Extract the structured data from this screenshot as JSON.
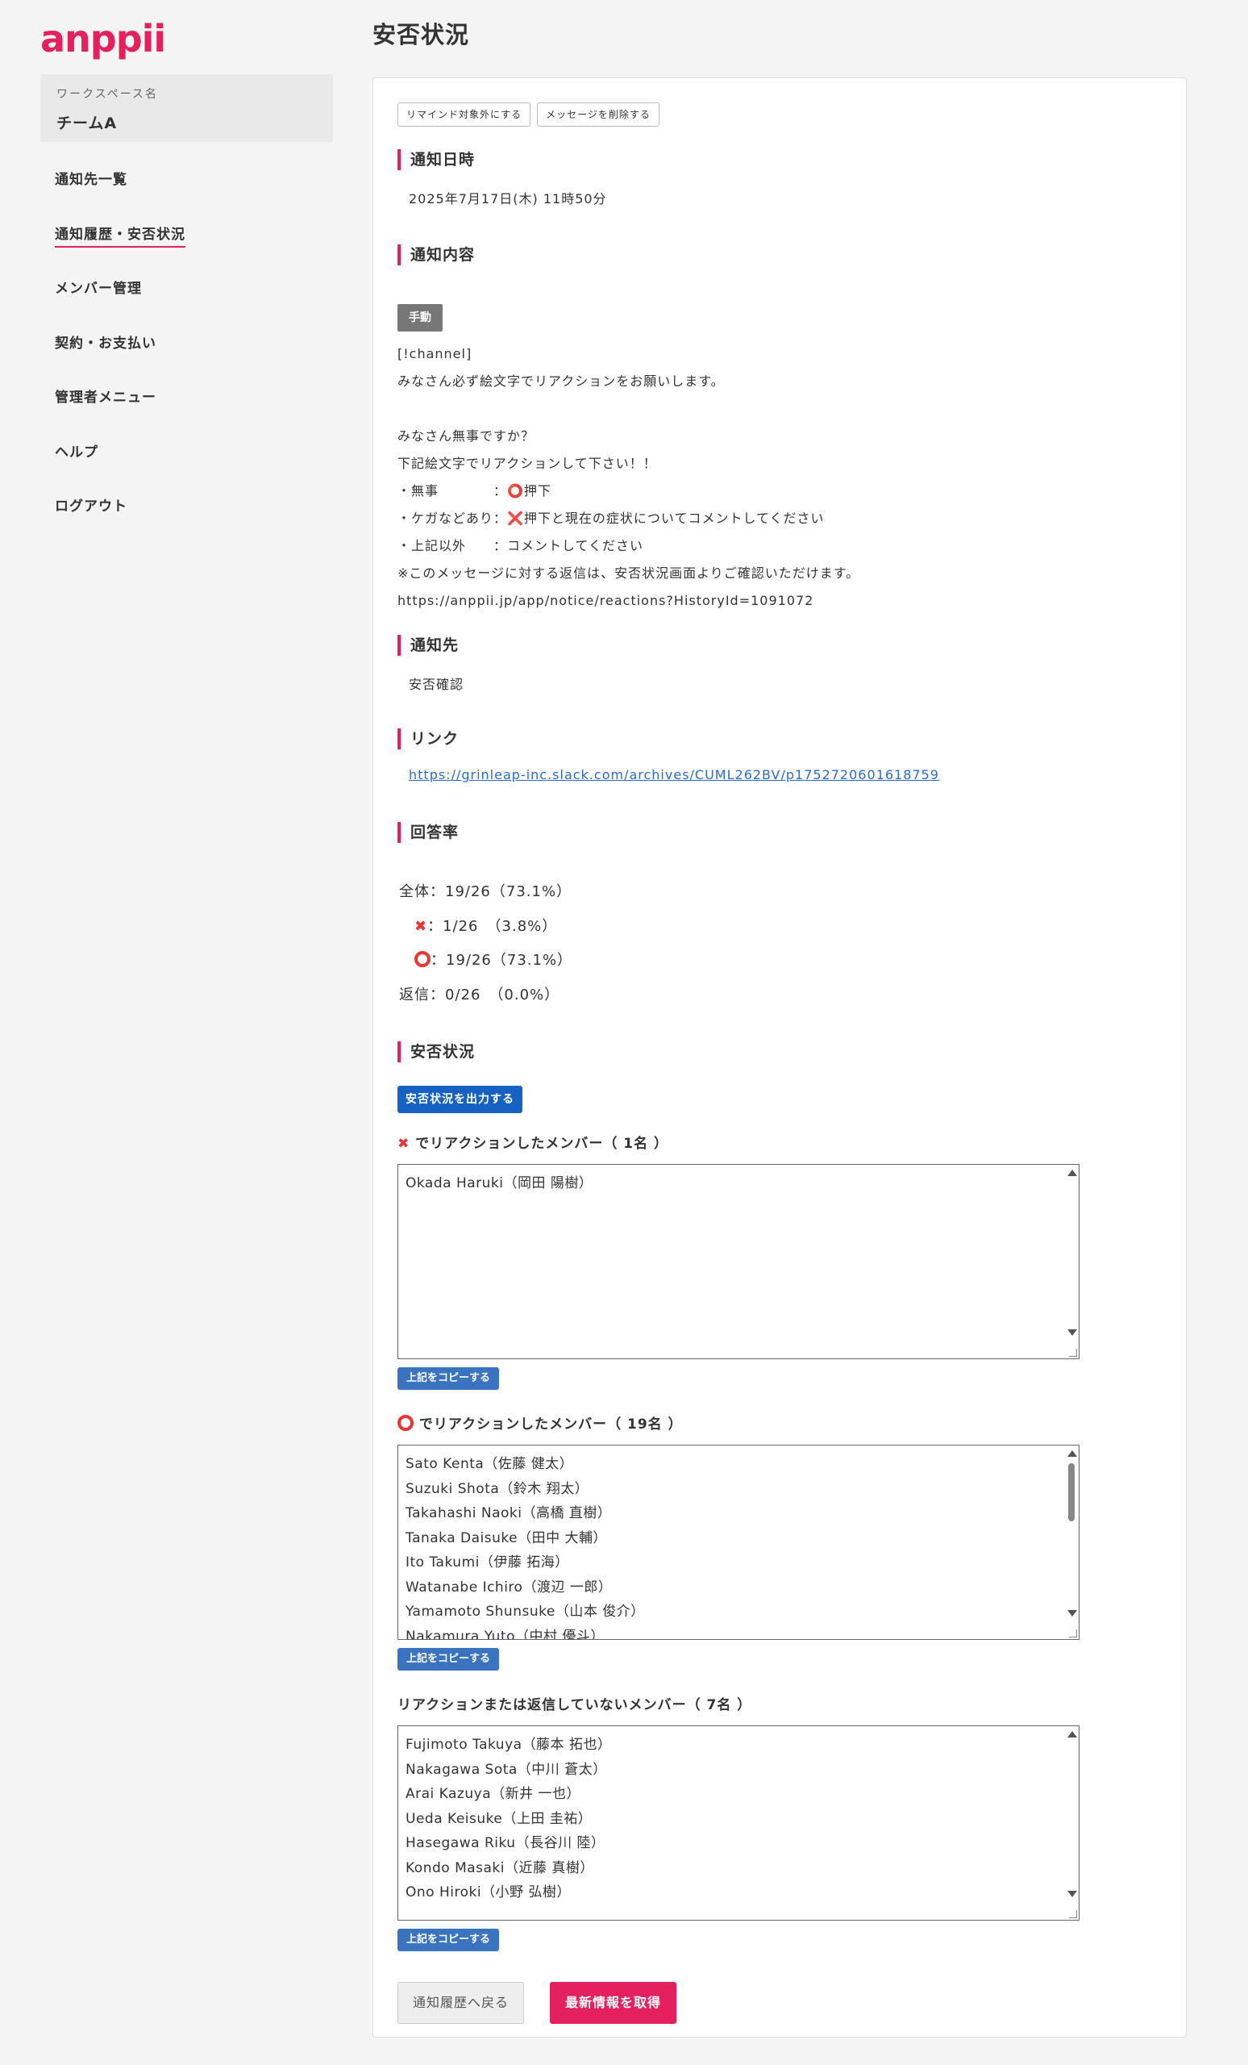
{
  "app": {
    "logo": "anppii"
  },
  "workspace": {
    "label": "ワークスペース名",
    "name": "チームA"
  },
  "sidebar": {
    "items": [
      {
        "label": "通知先一覧"
      },
      {
        "label": "通知履歴・安否状況"
      },
      {
        "label": "メンバー管理"
      },
      {
        "label": "契約・お支払い"
      },
      {
        "label": "管理者メニュー"
      },
      {
        "label": "ヘルプ"
      },
      {
        "label": "ログアウト"
      }
    ],
    "active_index": 1
  },
  "page": {
    "title": "安否状況"
  },
  "actions": {
    "exclude_remind": "リマインド対象外にする",
    "delete_message": "メッセージを削除する"
  },
  "notify_datetime": {
    "heading": "通知日時",
    "value": "2025年7月17日(木) 11時50分"
  },
  "notify_content": {
    "heading": "通知内容",
    "badge": "手動",
    "lines": [
      "[!channel]",
      "みなさん必ず絵文字でリアクションをお願いします。",
      "",
      "みなさん無事ですか？",
      "下記絵文字でリアクションして下さい！！",
      "・無事　　　　：⭕押下",
      "・ケガなどあり：❌押下と現在の症状についてコメントしてください",
      "・上記以外　　：コメントしてください",
      "※このメッセージに対する返信は、安否状況画面よりご確認いただけます。",
      "https://anppii.jp/app/notice/reactions?HistoryId=1091072"
    ]
  },
  "notify_target": {
    "heading": "通知先",
    "value": "安否確認"
  },
  "link": {
    "heading": "リンク",
    "url": "https://grinleap-inc.slack.com/archives/CUML262BV/p1752720601618759"
  },
  "response_rate": {
    "heading": "回答率",
    "total": "全体：19/26（73.1%）",
    "x": "：1/26　（3.8%）",
    "o": "：19/26（73.1%）",
    "reply": "返信：0/26　（0.0%）"
  },
  "safety": {
    "heading": "安否状況",
    "export_button": "安否状況を出力する",
    "copy_label": "上記をコピーする",
    "x_group": {
      "title": "でリアクションしたメンバー（ 1名 ）",
      "members": [
        "Okada Haruki（岡田 陽樹）"
      ]
    },
    "o_group": {
      "title": "でリアクションしたメンバー（ 19名 ）",
      "members": [
        "Sato Kenta（佐藤 健太）",
        "Suzuki Shota（鈴木 翔太）",
        "Takahashi Naoki（高橋 直樹）",
        "Tanaka Daisuke（田中 大輔）",
        "Ito Takumi（伊藤 拓海）",
        "Watanabe Ichiro（渡辺 一郎）",
        "Yamamoto Shunsuke（山本 俊介）",
        "Nakamura Yuto（中村 優斗）"
      ]
    },
    "none_group": {
      "title": "リアクションまたは返信していないメンバー（ 7名 ）",
      "members": [
        "Fujimoto Takuya（藤本 拓也）",
        "Nakagawa Sota（中川 蒼太）",
        "Arai Kazuya（新井 一也）",
        "Ueda Keisuke（上田 圭祐）",
        "Hasegawa Riku（長谷川 陸）",
        "Kondo Masaki（近藤 真樹）",
        "Ono Hiroki（小野 弘樹）"
      ]
    }
  },
  "footer": {
    "back": "通知履歴へ戻る",
    "refresh": "最新情報を取得"
  },
  "colors": {
    "brand": "#e4205e",
    "primary_blue": "#1662c4"
  }
}
